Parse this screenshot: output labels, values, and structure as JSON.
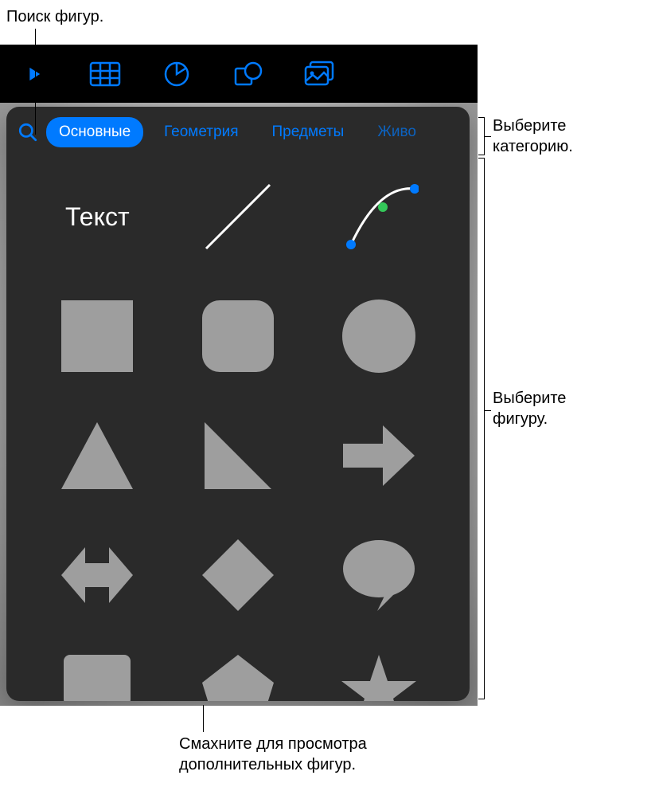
{
  "callouts": {
    "search": "Поиск фигур.",
    "category": "Выберите\nкатегорию.",
    "shape": "Выберите\nфигуру.",
    "swipe": "Смахните для просмотра\nдополнительных фигур."
  },
  "tabs": {
    "main": "Основные",
    "geometry": "Геометрия",
    "objects": "Предметы",
    "animals": "Живо"
  },
  "shapes": {
    "text_label": "Текст"
  },
  "toolbar_icons": {
    "play": "play-icon",
    "table": "table-icon",
    "chart": "chart-icon",
    "shape": "shape-icon",
    "media": "media-icon"
  }
}
